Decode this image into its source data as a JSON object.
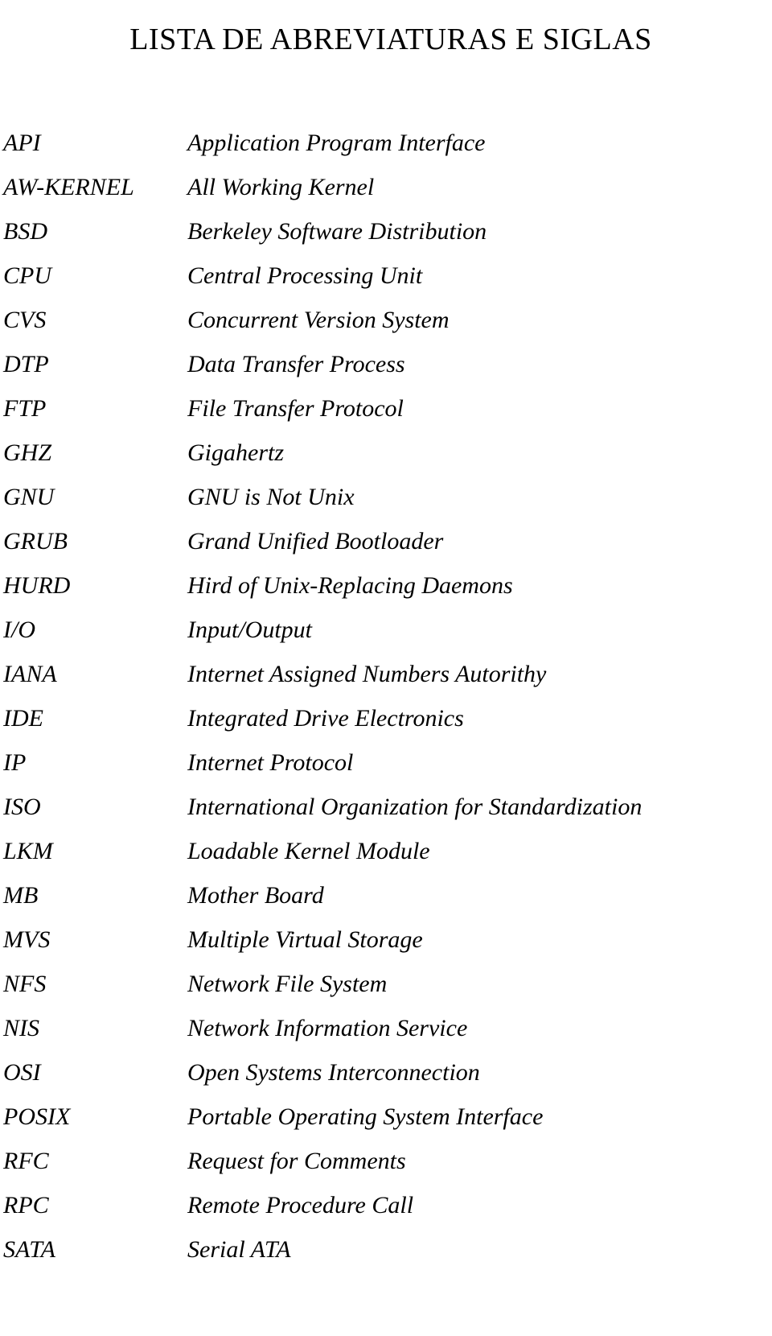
{
  "document": {
    "title": "LISTA DE ABREVIATURAS E SIGLAS",
    "background_color": "#ffffff",
    "text_color": "#000000"
  },
  "abbreviations": [
    {
      "term": "API",
      "definition": "Application Program Interface"
    },
    {
      "term": "AW-KERNEL",
      "definition": "All Working Kernel"
    },
    {
      "term": "BSD",
      "definition": "Berkeley Software Distribution"
    },
    {
      "term": "CPU",
      "definition": "Central Processing Unit"
    },
    {
      "term": "CVS",
      "definition": "Concurrent Version System"
    },
    {
      "term": "DTP",
      "definition": "Data Transfer Process"
    },
    {
      "term": "FTP",
      "definition": "File Transfer Protocol"
    },
    {
      "term": "GHZ",
      "definition": "Gigahertz"
    },
    {
      "term": "GNU",
      "definition": "GNU is Not Unix"
    },
    {
      "term": "GRUB",
      "definition": "Grand Unified Bootloader"
    },
    {
      "term": "HURD",
      "definition": "Hird of Unix-Replacing Daemons"
    },
    {
      "term": "I/O",
      "definition": "Input/Output"
    },
    {
      "term": "IANA",
      "definition": "Internet Assigned Numbers Autorithy"
    },
    {
      "term": "IDE",
      "definition": "Integrated Drive Electronics"
    },
    {
      "term": "IP",
      "definition": "Internet Protocol"
    },
    {
      "term": "ISO",
      "definition": "International Organization for Standardization"
    },
    {
      "term": "LKM",
      "definition": "Loadable Kernel Module"
    },
    {
      "term": "MB",
      "definition": "Mother Board"
    },
    {
      "term": "MVS",
      "definition": "Multiple Virtual Storage"
    },
    {
      "term": "NFS",
      "definition": "Network File System"
    },
    {
      "term": "NIS",
      "definition": "Network Information Service"
    },
    {
      "term": "OSI",
      "definition": "Open Systems Interconnection"
    },
    {
      "term": "POSIX",
      "definition": "Portable Operating System Interface"
    },
    {
      "term": "RFC",
      "definition": "Request for Comments"
    },
    {
      "term": "RPC",
      "definition": "Remote Procedure Call"
    },
    {
      "term": "SATA",
      "definition": "Serial ATA"
    }
  ]
}
